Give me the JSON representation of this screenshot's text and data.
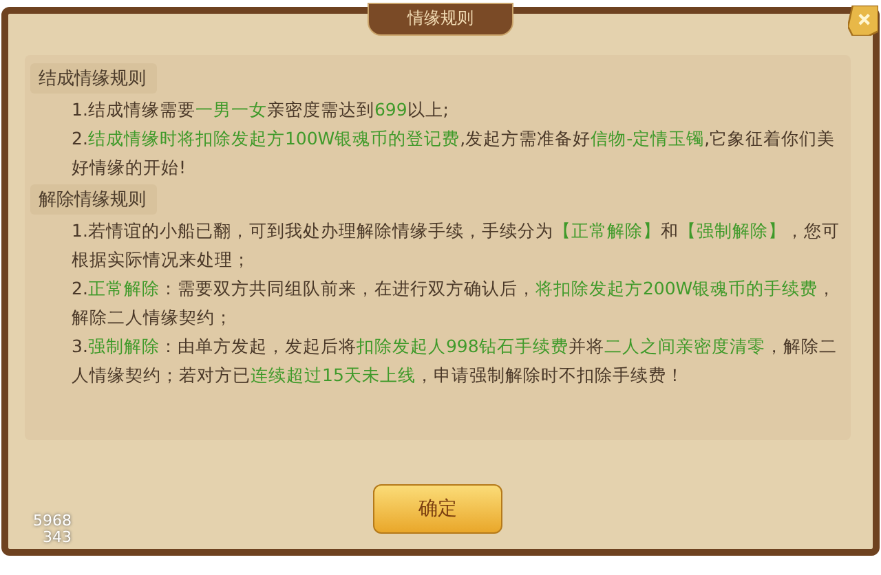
{
  "dialog": {
    "title": "情缘规则"
  },
  "sections": [
    {
      "heading": "结成情缘规则",
      "rules": [
        [
          {
            "text": "1.结成情缘需要",
            "highlight": false
          },
          {
            "text": "一男一女",
            "highlight": true
          },
          {
            "text": "亲密度需达到",
            "highlight": false
          },
          {
            "text": "699",
            "highlight": true
          },
          {
            "text": "以上;",
            "highlight": false
          }
        ],
        [
          {
            "text": "2.",
            "highlight": false
          },
          {
            "text": "结成情缘时将扣除发起方100W银魂币的登记费",
            "highlight": true
          },
          {
            "text": ",发起方需准备好",
            "highlight": false
          },
          {
            "text": "信物-定情玉镯",
            "highlight": true
          },
          {
            "text": ",它象征着你们美好情缘的开始!",
            "highlight": false
          }
        ]
      ]
    },
    {
      "heading": "解除情缘规则",
      "rules": [
        [
          {
            "text": "1.若情谊的小船已翻，可到我处办理解除情缘手续，手续分为",
            "highlight": false
          },
          {
            "text": "【正常解除】",
            "highlight": true
          },
          {
            "text": "和",
            "highlight": false
          },
          {
            "text": "【强制解除】",
            "highlight": true
          },
          {
            "text": "，您可根据实际情况来处理；",
            "highlight": false
          }
        ],
        [
          {
            "text": "2.",
            "highlight": false
          },
          {
            "text": "正常解除",
            "highlight": true
          },
          {
            "text": "：需要双方共同组队前来，在进行双方确认后，",
            "highlight": false
          },
          {
            "text": "将扣除发起方200W银魂币的手续费",
            "highlight": true
          },
          {
            "text": "，解除二人情缘契约；",
            "highlight": false
          }
        ],
        [
          {
            "text": "3.",
            "highlight": false
          },
          {
            "text": "强制解除",
            "highlight": true
          },
          {
            "text": "：由单方发起，发起后将",
            "highlight": false
          },
          {
            "text": "扣除发起人998钻石手续费",
            "highlight": true
          },
          {
            "text": "并将",
            "highlight": false
          },
          {
            "text": "二人之间亲密度清零",
            "highlight": true
          },
          {
            "text": "，解除二人情缘契约；若对方已",
            "highlight": false
          },
          {
            "text": "连续超过15天未上线",
            "highlight": true
          },
          {
            "text": "，申请强制解除时不扣除手续费！",
            "highlight": false
          }
        ]
      ]
    }
  ],
  "confirm_button": "确定",
  "debug_numbers": [
    "5968",
    "343"
  ]
}
